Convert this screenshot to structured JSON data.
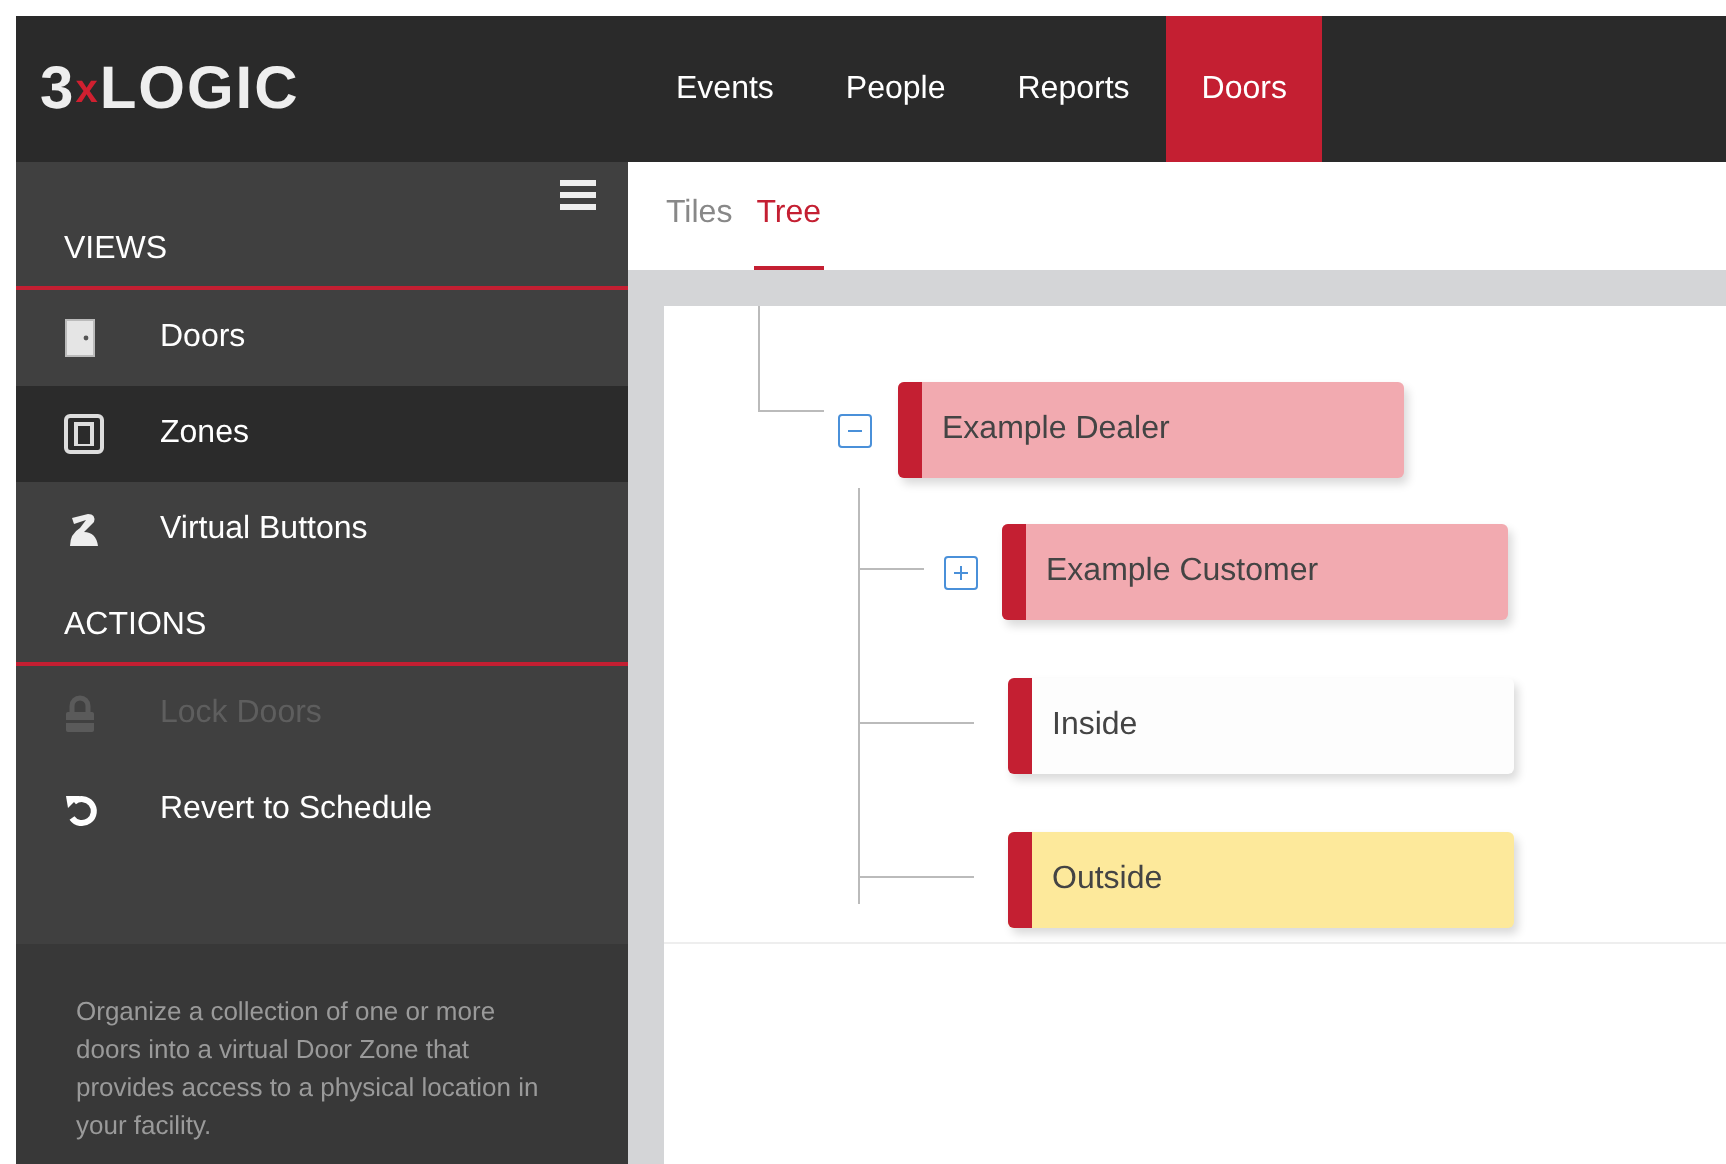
{
  "header": {
    "logo": {
      "prefix": "3",
      "mark": "x",
      "name": "LOGIC"
    },
    "nav": [
      {
        "label": "Events",
        "selected": false
      },
      {
        "label": "People",
        "selected": false
      },
      {
        "label": "Reports",
        "selected": false
      },
      {
        "label": "Doors",
        "selected": true
      }
    ]
  },
  "sidebar": {
    "sections": [
      {
        "title": "VIEWS",
        "items": [
          {
            "label": "Doors",
            "kind": "door",
            "selected": false,
            "disabled": false
          },
          {
            "label": "Zones",
            "kind": "zone",
            "selected": true,
            "disabled": false
          },
          {
            "label": "Virtual Buttons",
            "kind": "hand",
            "selected": false,
            "disabled": false
          }
        ]
      },
      {
        "title": "ACTIONS",
        "items": [
          {
            "label": "Lock Doors",
            "kind": "lock",
            "selected": false,
            "disabled": true
          },
          {
            "label": "Revert to Schedule",
            "kind": "revert",
            "selected": false,
            "disabled": false
          }
        ]
      }
    ],
    "description": "Organize a collection of one or more doors into a virtual Door Zone that provides access to a physical location in your facility."
  },
  "tabs": [
    {
      "label": "Tiles",
      "selected": false
    },
    {
      "label": "Tree",
      "selected": true
    }
  ],
  "tree": [
    {
      "label": "Example Dealer",
      "kind": "group",
      "expanded": true,
      "color": "#f2aab0",
      "children": [
        {
          "label": "Example Customer",
          "kind": "group",
          "expanded": false,
          "color": "#f2aab0"
        },
        {
          "label": "Inside",
          "kind": "leaf",
          "color": "#fdfdfd"
        },
        {
          "label": "Outside",
          "kind": "leaf",
          "color": "#fde99b"
        }
      ]
    }
  ]
}
